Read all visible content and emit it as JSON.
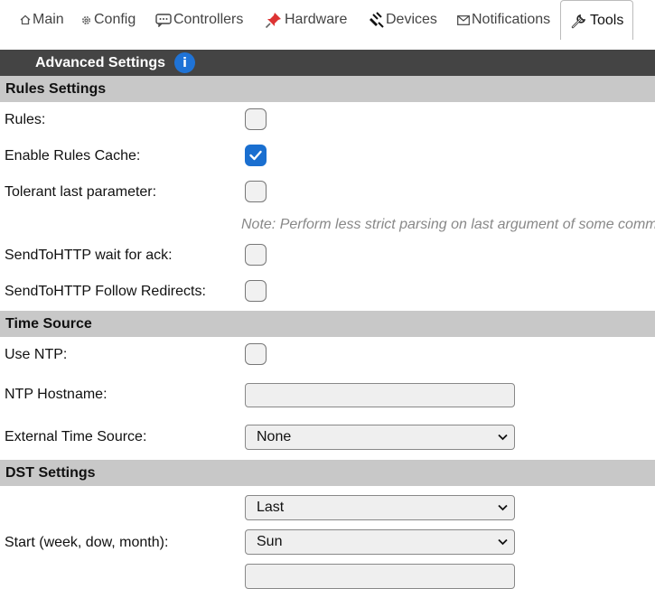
{
  "tabs": [
    {
      "label": "Main",
      "icon": "home-icon"
    },
    {
      "label": "Config",
      "icon": "gear-icon"
    },
    {
      "label": "Controllers",
      "icon": "chat-icon"
    },
    {
      "label": "Hardware",
      "icon": "pushpin-icon"
    },
    {
      "label": "Devices",
      "icon": "plug-icon"
    },
    {
      "label": "Notifications",
      "icon": "envelope-icon"
    },
    {
      "label": "Tools",
      "icon": "wrench-icon",
      "active": true
    }
  ],
  "header": {
    "title": "Advanced Settings",
    "info_glyph": "i"
  },
  "rules_settings": {
    "title": "Rules Settings",
    "rules": {
      "label": "Rules:",
      "checked": false
    },
    "rules_cache": {
      "label": "Enable Rules Cache:",
      "checked": true
    },
    "tolerant": {
      "label": "Tolerant last parameter:",
      "checked": false
    },
    "note": "Note: Perform less strict parsing on last argument of some comm",
    "sendtohttp_ack": {
      "label": "SendToHTTP wait for ack:",
      "checked": false
    },
    "sendtohttp_redirects": {
      "label": "SendToHTTP Follow Redirects:",
      "checked": false
    }
  },
  "time_source": {
    "title": "Time Source",
    "use_ntp": {
      "label": "Use NTP:",
      "checked": false
    },
    "ntp_hostname": {
      "label": "NTP Hostname:",
      "value": ""
    },
    "external_source": {
      "label": "External Time Source:",
      "value": "None"
    }
  },
  "dst_settings": {
    "title": "DST Settings",
    "start_label": "Start (week, dow, month):",
    "start_week": "Last",
    "start_dow": "Sun"
  }
}
